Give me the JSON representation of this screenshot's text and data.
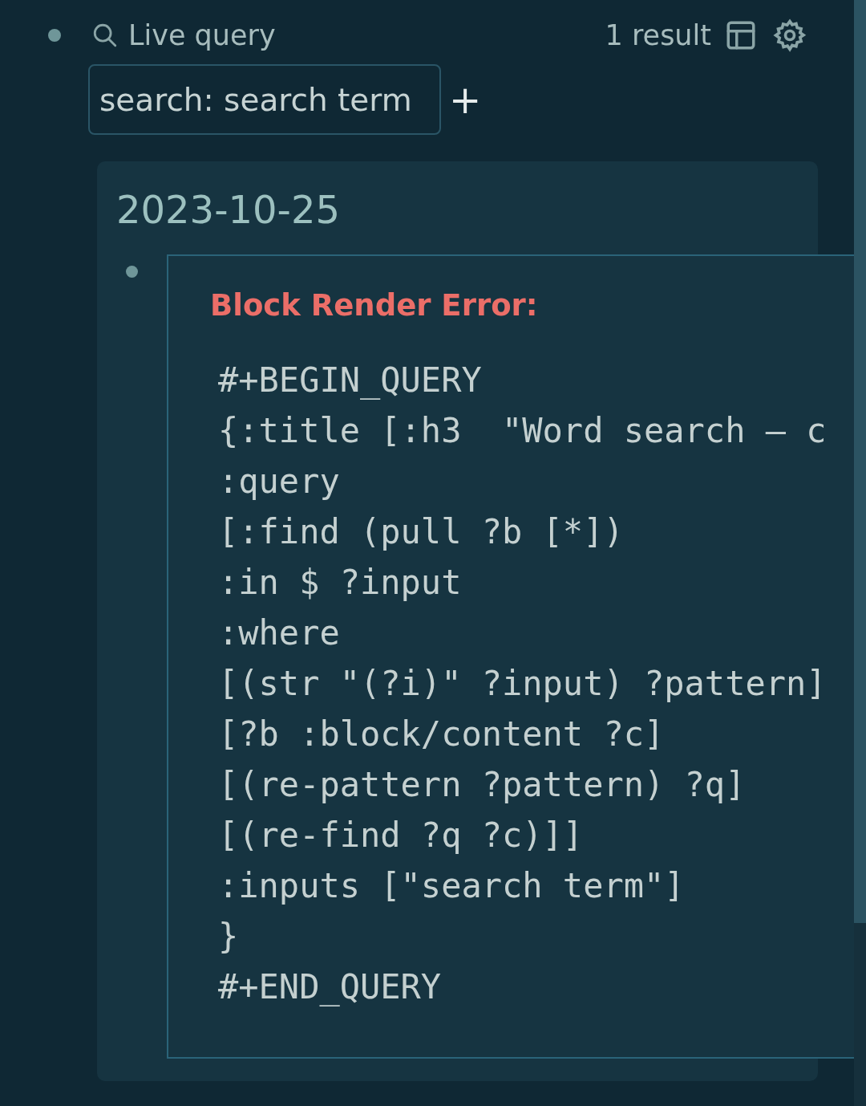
{
  "query": {
    "title": "Live query",
    "result_count": "1 result"
  },
  "input": {
    "value": "search: search term"
  },
  "add_button": "+",
  "results": [
    {
      "date": "2023-10-25",
      "error": {
        "title": "Block Render Error:",
        "code_lines": [
          "#+BEGIN_QUERY",
          "{:title [:h3  \"Word search — c",
          ":query",
          "[:find (pull ?b [*])",
          ":in $ ?input",
          ":where",
          "[(str \"(?i)\" ?input) ?pattern]",
          "[?b :block/content ?c]",
          "[(re-pattern ?pattern) ?q]",
          "[(re-find ?q ?c)]]",
          ":inputs [\"search term\"]",
          "}",
          "#+END_QUERY"
        ]
      }
    }
  ]
}
